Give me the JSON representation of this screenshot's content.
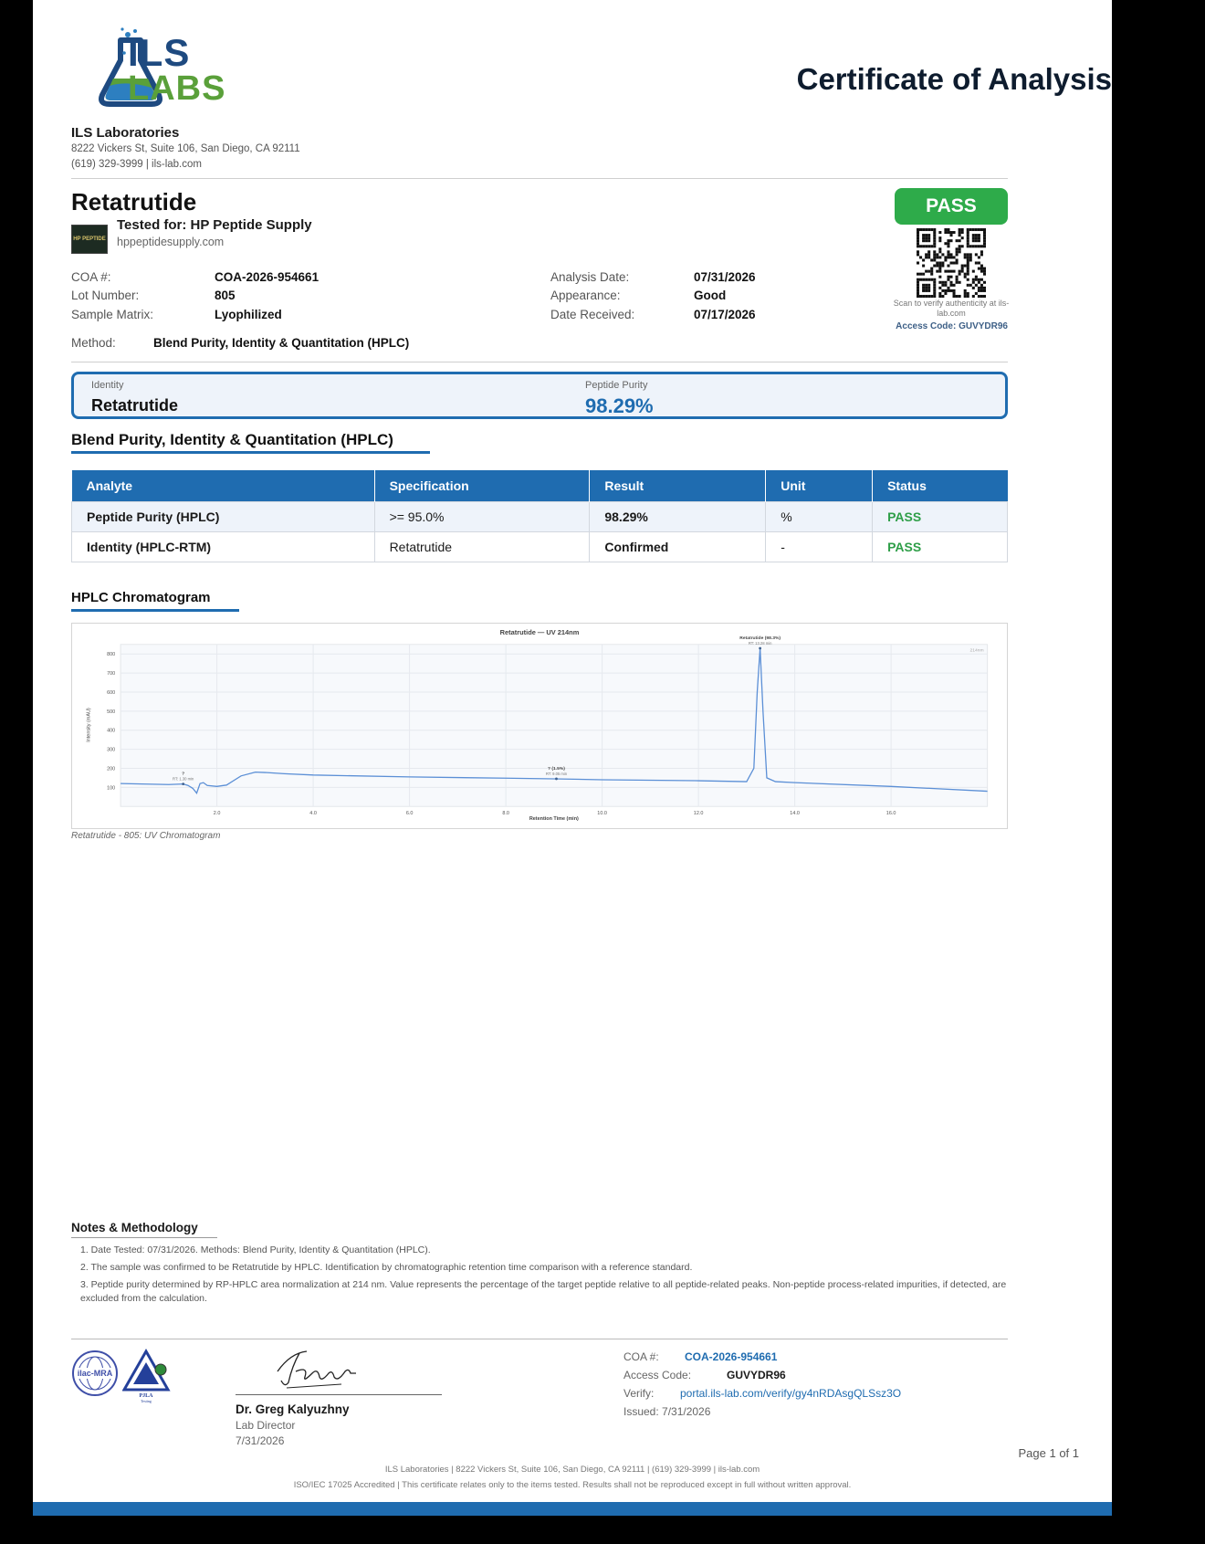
{
  "lab": {
    "logo_top": "ILS",
    "logo_bottom": "LABS",
    "name": "ILS Laboratories",
    "address": "8222 Vickers St, Suite 106, San Diego, CA 92111",
    "contact": "(619) 329-3999  |  ils-lab.com"
  },
  "title": "Certificate of Analysis",
  "product": {
    "name": "Retatrutide",
    "tested_for": "Tested for: HP Peptide Supply",
    "client_url": "hppeptidesupply.com",
    "client_logo_text": "HP PEPTIDE"
  },
  "badge": {
    "status": "PASS",
    "scan_text": "Scan to verify authenticity at ils-lab.com",
    "access_code": "Access Code: GUVYDR96"
  },
  "meta": {
    "coa_label": "COA #:",
    "coa_value": "COA-2026-954661",
    "lot_label": "Lot Number:",
    "lot_value": "805",
    "matrix_label": "Sample Matrix:",
    "matrix_value": "Lyophilized",
    "analysis_date_label": "Analysis Date:",
    "analysis_date_value": "07/31/2026",
    "appearance_label": "Appearance:",
    "appearance_value": "Good",
    "received_label": "Date Received:",
    "received_value": "07/17/2026",
    "method_label": "Method:",
    "method_value": "Blend Purity, Identity & Quantitation (HPLC)"
  },
  "summary": {
    "identity_label": "Identity",
    "identity_value": "Retatrutide",
    "purity_label": "Peptide Purity",
    "purity_value": "98.29%"
  },
  "results_section_title": "Blend Purity, Identity & Quantitation (HPLC)",
  "results": {
    "headers": [
      "Analyte",
      "Specification",
      "Result",
      "Unit",
      "Status"
    ],
    "rows": [
      [
        "Peptide Purity (HPLC)",
        ">= 95.0%",
        "98.29%",
        "%",
        "PASS"
      ],
      [
        "Identity (HPLC-RTM)",
        "Retatrutide",
        "Confirmed",
        "-",
        "PASS"
      ]
    ]
  },
  "chromatogram_section_title": "HPLC Chromatogram",
  "chromatogram_caption": "Retatrutide - 805: UV Chromatogram",
  "chart_data": {
    "type": "line",
    "title": "Retatrutide — UV 214nm",
    "xlabel": "Retention Time (min)",
    "ylabel": "Intensity (mAU)",
    "legend": "214nm",
    "xlim": [
      0,
      18
    ],
    "ylim": [
      0,
      850
    ],
    "x_ticks": [
      "2.0",
      "4.0",
      "6.0",
      "8.0",
      "10.0",
      "12.0",
      "14.0",
      "16.0"
    ],
    "y_ticks": [
      "100",
      "200",
      "300",
      "400",
      "500",
      "600",
      "700",
      "800"
    ],
    "series": [
      {
        "x": [
          0,
          1.0,
          1.3,
          1.4,
          1.5,
          1.58,
          1.65,
          1.72,
          1.8,
          2.0,
          2.2,
          2.5,
          2.8,
          3.0,
          3.4,
          4.0,
          6.0,
          8.0,
          9.0,
          10.0,
          12.0,
          13.0,
          13.15,
          13.22,
          13.28,
          13.34,
          13.42,
          13.6,
          14.0,
          16.0,
          18.0
        ],
        "y": [
          120,
          115,
          118,
          110,
          95,
          70,
          120,
          125,
          110,
          105,
          112,
          160,
          180,
          178,
          172,
          165,
          155,
          148,
          145,
          140,
          135,
          130,
          200,
          600,
          830,
          500,
          150,
          130,
          125,
          105,
          80
        ]
      }
    ],
    "annotations": [
      {
        "x": 1.3,
        "y": 118,
        "label": "?",
        "sublabel": "RT: 1.30 min"
      },
      {
        "x": 9.05,
        "y": 145,
        "label": "? (1.5%)",
        "sublabel": "RT: 9.05 min"
      },
      {
        "x": 13.28,
        "y": 830,
        "label": "Retatrutide (98.3%)",
        "sublabel": "RT: 13.28 min"
      }
    ]
  },
  "notes": {
    "title": "Notes & Methodology",
    "items": [
      "1. Date Tested: 07/31/2026. Methods: Blend Purity, Identity & Quantitation (HPLC).",
      "2. The sample was confirmed to be Retatrutide by HPLC. Identification by chromatographic retention time comparison with a reference standard.",
      "3. Peptide purity determined by RP-HPLC area normalization at 214 nm. Value represents the percentage of the target peptide relative to all peptide-related peaks. Non-peptide process-related impurities, if detected, are excluded from the calculation."
    ]
  },
  "accreditation": {
    "ilac_text": "ilac-MRA",
    "pjla_text": "PJLA",
    "pjla_sub": "Testing"
  },
  "signature": {
    "name": "Dr. Greg Kalyuzhny",
    "title": "Lab Director",
    "date": "7/31/2026"
  },
  "footer_info": {
    "coa_label": "COA #:",
    "coa_value": "COA-2026-954661",
    "access_label": "Access Code:",
    "access_value": "GUVYDR96",
    "verify_label": "Verify:",
    "verify_value": "portal.ils-lab.com/verify/gy4nRDAsgQLSsz3O",
    "issued": "Issued: 7/31/2026"
  },
  "page_number": "Page 1 of 1",
  "footer": {
    "line1": "ILS Laboratories  |  8222 Vickers St, Suite 106, San Diego, CA 92111  |  (619) 329-3999  |  ils-lab.com",
    "line2": "ISO/IEC 17025 Accredited  |  This certificate relates only to the items tested. Results shall not be reproduced except in full without written approval."
  },
  "colors": {
    "primary": "#1f6cb0",
    "pass": "#2eab4a",
    "logo_blue": "#1e4a80",
    "logo_green": "#5aa03a"
  }
}
